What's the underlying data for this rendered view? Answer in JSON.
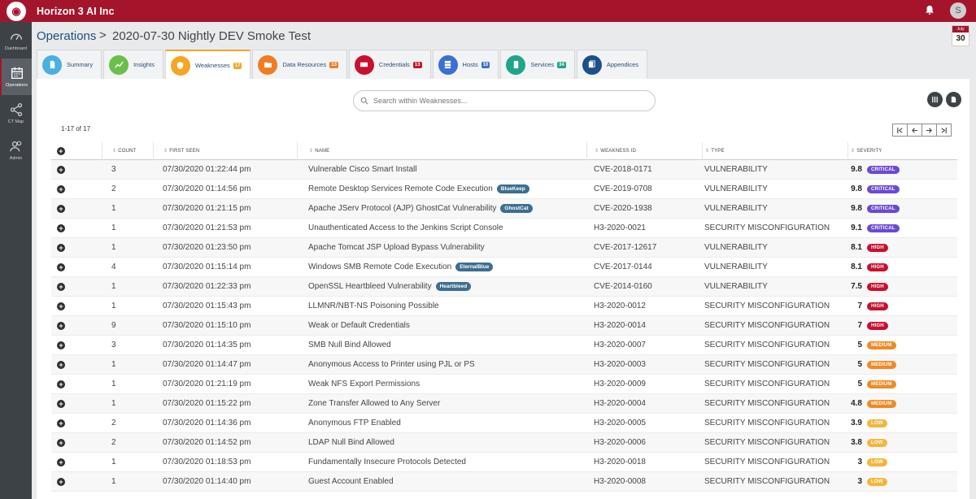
{
  "app": {
    "org_name": "Horizon 3 AI Inc",
    "avatar_initial": "S",
    "calendar_month": "July",
    "calendar_day": "30"
  },
  "nav": [
    {
      "label": "Dashboard",
      "icon": "gauge-icon"
    },
    {
      "label": "Operations",
      "icon": "calendar-icon"
    },
    {
      "label": "CT Map",
      "icon": "share-icon"
    },
    {
      "label": "Admin",
      "icon": "users-icon"
    }
  ],
  "breadcrumb": {
    "root": "Operations",
    "separator": ">",
    "page": "2020-07-30 Nightly DEV Smoke Test"
  },
  "tabs": [
    {
      "label": "Summary",
      "icon": "document-icon",
      "color": "#4ab0e0",
      "badge": ""
    },
    {
      "label": "Insights",
      "icon": "chart-icon",
      "color": "#6ac04a",
      "badge": ""
    },
    {
      "label": "Weaknesses",
      "icon": "shield-icon",
      "color": "#f5a623",
      "badge": "17",
      "badge_color": "#f5a623"
    },
    {
      "label": "Data Resources",
      "icon": "folder-icon",
      "color": "#f07c24",
      "badge": "13",
      "badge_color": "#f07c24"
    },
    {
      "label": "Credentials",
      "icon": "key-icon",
      "color": "#c8102e",
      "badge": "13",
      "badge_color": "#c8102e"
    },
    {
      "label": "Hosts",
      "icon": "server-icon",
      "color": "#3b6fd1",
      "badge": "10",
      "badge_color": "#3b6fd1"
    },
    {
      "label": "Services",
      "icon": "device-icon",
      "color": "#1ea58a",
      "badge": "34",
      "badge_color": "#1ea58a"
    },
    {
      "label": "Appendices",
      "icon": "book-icon",
      "color": "#1f4f8a",
      "badge": ""
    }
  ],
  "search": {
    "placeholder": "Search within Weaknesses..."
  },
  "results_label": "1-17 of 17",
  "columns": [
    "COUNT",
    "FIRST SEEN",
    "NAME",
    "WEAKNESS ID",
    "TYPE",
    "SEVERITY"
  ],
  "rows": [
    {
      "count": "3",
      "first_seen": "07/30/2020 01:22:44 pm",
      "name": "Vulnerable Cisco Smart Install",
      "tag": "",
      "id": "CVE-2018-0171",
      "type": "VULNERABILITY",
      "score": "9.8",
      "severity": "CRITICAL"
    },
    {
      "count": "2",
      "first_seen": "07/30/2020 01:14:56 pm",
      "name": "Remote Desktop Services Remote Code Execution",
      "tag": "BlueKeep",
      "id": "CVE-2019-0708",
      "type": "VULNERABILITY",
      "score": "9.8",
      "severity": "CRITICAL"
    },
    {
      "count": "1",
      "first_seen": "07/30/2020 01:21:15 pm",
      "name": "Apache JServ Protocol (AJP) GhostCat Vulnerability",
      "tag": "GhostCat",
      "id": "CVE-2020-1938",
      "type": "VULNERABILITY",
      "score": "9.8",
      "severity": "CRITICAL"
    },
    {
      "count": "1",
      "first_seen": "07/30/2020 01:21:53 pm",
      "name": "Unauthenticated Access to the Jenkins Script Console",
      "tag": "",
      "id": "H3-2020-0021",
      "type": "SECURITY MISCONFIGURATION",
      "score": "9.1",
      "severity": "CRITICAL"
    },
    {
      "count": "1",
      "first_seen": "07/30/2020 01:23:50 pm",
      "name": "Apache Tomcat JSP Upload Bypass Vulnerability",
      "tag": "",
      "id": "CVE-2017-12617",
      "type": "VULNERABILITY",
      "score": "8.1",
      "severity": "HIGH"
    },
    {
      "count": "4",
      "first_seen": "07/30/2020 01:15:14 pm",
      "name": "Windows SMB Remote Code Execution",
      "tag": "EternalBlue",
      "id": "CVE-2017-0144",
      "type": "VULNERABILITY",
      "score": "8.1",
      "severity": "HIGH"
    },
    {
      "count": "1",
      "first_seen": "07/30/2020 01:22:33 pm",
      "name": "OpenSSL Heartbleed Vulnerability",
      "tag": "Heartbleed",
      "id": "CVE-2014-0160",
      "type": "VULNERABILITY",
      "score": "7.5",
      "severity": "HIGH"
    },
    {
      "count": "1",
      "first_seen": "07/30/2020 01:15:43 pm",
      "name": "LLMNR/NBT-NS Poisoning Possible",
      "tag": "",
      "id": "H3-2020-0012",
      "type": "SECURITY MISCONFIGURATION",
      "score": "7",
      "severity": "HIGH"
    },
    {
      "count": "9",
      "first_seen": "07/30/2020 01:15:10 pm",
      "name": "Weak or Default Credentials",
      "tag": "",
      "id": "H3-2020-0014",
      "type": "SECURITY MISCONFIGURATION",
      "score": "7",
      "severity": "HIGH"
    },
    {
      "count": "3",
      "first_seen": "07/30/2020 01:14:35 pm",
      "name": "SMB Null Bind Allowed",
      "tag": "",
      "id": "H3-2020-0007",
      "type": "SECURITY MISCONFIGURATION",
      "score": "5",
      "severity": "MEDIUM"
    },
    {
      "count": "1",
      "first_seen": "07/30/2020 01:14:47 pm",
      "name": "Anonymous Access to Printer using PJL or PS",
      "tag": "",
      "id": "H3-2020-0003",
      "type": "SECURITY MISCONFIGURATION",
      "score": "5",
      "severity": "MEDIUM"
    },
    {
      "count": "1",
      "first_seen": "07/30/2020 01:21:19 pm",
      "name": "Weak NFS Export Permissions",
      "tag": "",
      "id": "H3-2020-0009",
      "type": "SECURITY MISCONFIGURATION",
      "score": "5",
      "severity": "MEDIUM"
    },
    {
      "count": "1",
      "first_seen": "07/30/2020 01:15:22 pm",
      "name": "Zone Transfer Allowed to Any Server",
      "tag": "",
      "id": "H3-2020-0004",
      "type": "SECURITY MISCONFIGURATION",
      "score": "4.8",
      "severity": "MEDIUM"
    },
    {
      "count": "2",
      "first_seen": "07/30/2020 01:14:36 pm",
      "name": "Anonymous FTP Enabled",
      "tag": "",
      "id": "H3-2020-0005",
      "type": "SECURITY MISCONFIGURATION",
      "score": "3.9",
      "severity": "LOW"
    },
    {
      "count": "2",
      "first_seen": "07/30/2020 01:14:52 pm",
      "name": "LDAP Null Bind Allowed",
      "tag": "",
      "id": "H3-2020-0006",
      "type": "SECURITY MISCONFIGURATION",
      "score": "3.8",
      "severity": "LOW"
    },
    {
      "count": "1",
      "first_seen": "07/30/2020 01:18:53 pm",
      "name": "Fundamentally Insecure Protocols Detected",
      "tag": "",
      "id": "H3-2020-0018",
      "type": "SECURITY MISCONFIGURATION",
      "score": "3",
      "severity": "LOW"
    },
    {
      "count": "1",
      "first_seen": "07/30/2020 01:14:40 pm",
      "name": "Guest Account Enabled",
      "tag": "",
      "id": "H3-2020-0008",
      "type": "SECURITY MISCONFIGURATION",
      "score": "3",
      "severity": "LOW"
    }
  ]
}
